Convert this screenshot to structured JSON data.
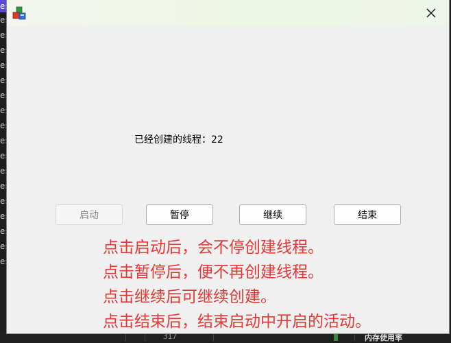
{
  "window": {
    "close_label": "×"
  },
  "status": {
    "text": "已经创建的线程：22"
  },
  "buttons": {
    "start": "启动",
    "pause": "暂停",
    "resume": "继续",
    "end": "结束"
  },
  "notes": [
    "点击启动后，会不停创建线程。",
    "点击暂停后，便不再创建线程。",
    "点击继续后可继续创建。",
    "点击结束后，结束启动中开启的活动。"
  ],
  "background": {
    "bottom_number": "317",
    "bottom_caption": "内存使用率",
    "strip_lines": [
      "es",
      "es",
      "es",
      "es",
      "es",
      "es",
      "es",
      "es",
      "es",
      "es",
      "es",
      "es",
      "es",
      "es",
      "es",
      "es",
      "es",
      "es"
    ]
  },
  "colors": {
    "note_red": "#e53935",
    "window_bg": "#f0f0f0",
    "disabled_text": "#8a8a8a"
  },
  "icons": {
    "app": "app-cubes-icon",
    "close": "close-icon"
  }
}
